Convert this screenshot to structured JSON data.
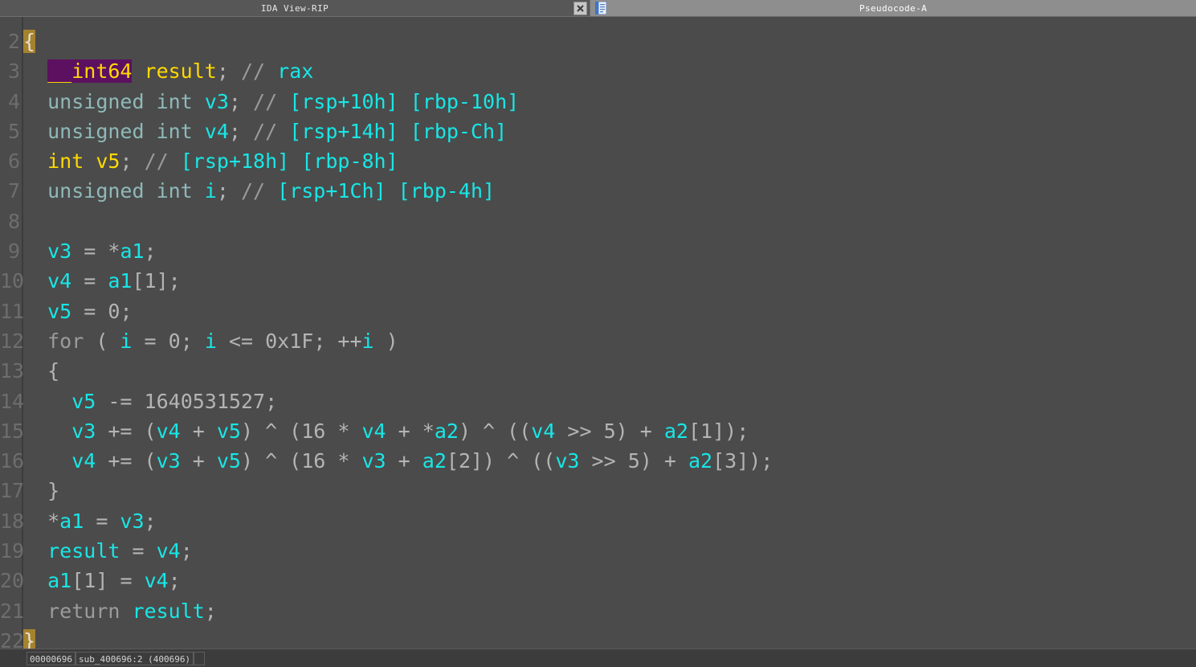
{
  "window": {
    "tabs": [
      {
        "label": "IDA View-RIP",
        "active": false,
        "icon": "close-icon"
      },
      {
        "label": "Pseudocode-A",
        "active": true,
        "icon": "pseudocode-document-icon"
      }
    ],
    "close_glyph": "✖"
  },
  "editor": {
    "first_line_number": 2,
    "lines": [
      {
        "n": "2",
        "tokens": [
          {
            "t": "{",
            "c": "hl-brace"
          }
        ]
      },
      {
        "n": "3",
        "tokens": [
          {
            "t": "  ",
            "c": "punc"
          },
          {
            "t": "__int64",
            "c": "kw hl-type"
          },
          {
            "t": " ",
            "c": "punc"
          },
          {
            "t": "result",
            "c": "fn"
          },
          {
            "t": ";",
            "c": "punc"
          },
          {
            "t": " ",
            "c": "punc"
          },
          {
            "t": "//",
            "c": "cmt"
          },
          {
            "t": " ",
            "c": "punc"
          },
          {
            "t": "rax",
            "c": "reg"
          }
        ]
      },
      {
        "n": "4",
        "tokens": [
          {
            "t": "  ",
            "c": "punc"
          },
          {
            "t": "unsigned int",
            "c": "kwdim"
          },
          {
            "t": " ",
            "c": "punc"
          },
          {
            "t": "v3",
            "c": "var"
          },
          {
            "t": ";",
            "c": "punc"
          },
          {
            "t": " ",
            "c": "punc"
          },
          {
            "t": "//",
            "c": "cmt"
          },
          {
            "t": " ",
            "c": "punc"
          },
          {
            "t": "[rsp+10h] [rbp-10h]",
            "c": "reg"
          }
        ]
      },
      {
        "n": "5",
        "tokens": [
          {
            "t": "  ",
            "c": "punc"
          },
          {
            "t": "unsigned int",
            "c": "kwdim"
          },
          {
            "t": " ",
            "c": "punc"
          },
          {
            "t": "v4",
            "c": "var"
          },
          {
            "t": ";",
            "c": "punc"
          },
          {
            "t": " ",
            "c": "punc"
          },
          {
            "t": "//",
            "c": "cmt"
          },
          {
            "t": " ",
            "c": "punc"
          },
          {
            "t": "[rsp+14h] [rbp-Ch]",
            "c": "reg"
          }
        ]
      },
      {
        "n": "6",
        "tokens": [
          {
            "t": "  ",
            "c": "punc"
          },
          {
            "t": "int",
            "c": "kw"
          },
          {
            "t": " ",
            "c": "punc"
          },
          {
            "t": "v5",
            "c": "fn"
          },
          {
            "t": ";",
            "c": "punc"
          },
          {
            "t": " ",
            "c": "punc"
          },
          {
            "t": "//",
            "c": "cmt"
          },
          {
            "t": " ",
            "c": "punc"
          },
          {
            "t": "[rsp+18h] [rbp-8h]",
            "c": "reg"
          }
        ]
      },
      {
        "n": "7",
        "tokens": [
          {
            "t": "  ",
            "c": "punc"
          },
          {
            "t": "unsigned int",
            "c": "kwdim"
          },
          {
            "t": " ",
            "c": "punc"
          },
          {
            "t": "i",
            "c": "var"
          },
          {
            "t": ";",
            "c": "punc"
          },
          {
            "t": " ",
            "c": "punc"
          },
          {
            "t": "//",
            "c": "cmt"
          },
          {
            "t": " ",
            "c": "punc"
          },
          {
            "t": "[rsp+1Ch] [rbp-4h]",
            "c": "reg"
          }
        ]
      },
      {
        "n": "8",
        "tokens": []
      },
      {
        "n": "9",
        "tokens": [
          {
            "t": "  ",
            "c": "punc"
          },
          {
            "t": "v3",
            "c": "var"
          },
          {
            "t": " = *",
            "c": "punc"
          },
          {
            "t": "a1",
            "c": "var"
          },
          {
            "t": ";",
            "c": "punc"
          }
        ]
      },
      {
        "n": "10",
        "tokens": [
          {
            "t": "  ",
            "c": "punc"
          },
          {
            "t": "v4",
            "c": "var"
          },
          {
            "t": " = ",
            "c": "punc"
          },
          {
            "t": "a1",
            "c": "var"
          },
          {
            "t": "[",
            "c": "punc"
          },
          {
            "t": "1",
            "c": "num"
          },
          {
            "t": "];",
            "c": "punc"
          }
        ]
      },
      {
        "n": "11",
        "tokens": [
          {
            "t": "  ",
            "c": "punc"
          },
          {
            "t": "v5",
            "c": "var"
          },
          {
            "t": " = ",
            "c": "punc"
          },
          {
            "t": "0",
            "c": "num"
          },
          {
            "t": ";",
            "c": "punc"
          }
        ]
      },
      {
        "n": "12",
        "tokens": [
          {
            "t": "  ",
            "c": "punc"
          },
          {
            "t": "for",
            "c": "cmt"
          },
          {
            "t": " ( ",
            "c": "punc"
          },
          {
            "t": "i",
            "c": "var"
          },
          {
            "t": " = ",
            "c": "punc"
          },
          {
            "t": "0",
            "c": "num"
          },
          {
            "t": "; ",
            "c": "punc"
          },
          {
            "t": "i",
            "c": "var"
          },
          {
            "t": " <= ",
            "c": "punc"
          },
          {
            "t": "0x1F",
            "c": "num"
          },
          {
            "t": "; ++",
            "c": "punc"
          },
          {
            "t": "i",
            "c": "var"
          },
          {
            "t": " )",
            "c": "punc"
          }
        ]
      },
      {
        "n": "13",
        "tokens": [
          {
            "t": "  {",
            "c": "punc"
          }
        ]
      },
      {
        "n": "14",
        "tokens": [
          {
            "t": "    ",
            "c": "punc"
          },
          {
            "t": "v5",
            "c": "var"
          },
          {
            "t": " -= ",
            "c": "punc"
          },
          {
            "t": "1640531527",
            "c": "num"
          },
          {
            "t": ";",
            "c": "punc"
          }
        ]
      },
      {
        "n": "15",
        "tokens": [
          {
            "t": "    ",
            "c": "punc"
          },
          {
            "t": "v3",
            "c": "var"
          },
          {
            "t": " += (",
            "c": "punc"
          },
          {
            "t": "v4",
            "c": "var"
          },
          {
            "t": " + ",
            "c": "punc"
          },
          {
            "t": "v5",
            "c": "var"
          },
          {
            "t": ") ^ (",
            "c": "punc"
          },
          {
            "t": "16",
            "c": "num"
          },
          {
            "t": " * ",
            "c": "punc"
          },
          {
            "t": "v4",
            "c": "var"
          },
          {
            "t": " + *",
            "c": "punc"
          },
          {
            "t": "a2",
            "c": "var"
          },
          {
            "t": ") ^ ((",
            "c": "punc"
          },
          {
            "t": "v4",
            "c": "var"
          },
          {
            "t": " >> ",
            "c": "punc"
          },
          {
            "t": "5",
            "c": "num"
          },
          {
            "t": ") + ",
            "c": "punc"
          },
          {
            "t": "a2",
            "c": "var"
          },
          {
            "t": "[",
            "c": "punc"
          },
          {
            "t": "1",
            "c": "num"
          },
          {
            "t": "]);",
            "c": "punc"
          }
        ]
      },
      {
        "n": "16",
        "tokens": [
          {
            "t": "    ",
            "c": "punc"
          },
          {
            "t": "v4",
            "c": "var"
          },
          {
            "t": " += (",
            "c": "punc"
          },
          {
            "t": "v3",
            "c": "var"
          },
          {
            "t": " + ",
            "c": "punc"
          },
          {
            "t": "v5",
            "c": "var"
          },
          {
            "t": ") ^ (",
            "c": "punc"
          },
          {
            "t": "16",
            "c": "num"
          },
          {
            "t": " * ",
            "c": "punc"
          },
          {
            "t": "v3",
            "c": "var"
          },
          {
            "t": " + ",
            "c": "punc"
          },
          {
            "t": "a2",
            "c": "var"
          },
          {
            "t": "[",
            "c": "punc"
          },
          {
            "t": "2",
            "c": "num"
          },
          {
            "t": "]) ^ ((",
            "c": "punc"
          },
          {
            "t": "v3",
            "c": "var"
          },
          {
            "t": " >> ",
            "c": "punc"
          },
          {
            "t": "5",
            "c": "num"
          },
          {
            "t": ") + ",
            "c": "punc"
          },
          {
            "t": "a2",
            "c": "var"
          },
          {
            "t": "[",
            "c": "punc"
          },
          {
            "t": "3",
            "c": "num"
          },
          {
            "t": "]);",
            "c": "punc"
          }
        ]
      },
      {
        "n": "17",
        "tokens": [
          {
            "t": "  }",
            "c": "punc"
          }
        ]
      },
      {
        "n": "18",
        "tokens": [
          {
            "t": "  *",
            "c": "punc"
          },
          {
            "t": "a1",
            "c": "var"
          },
          {
            "t": " = ",
            "c": "punc"
          },
          {
            "t": "v3",
            "c": "var"
          },
          {
            "t": ";",
            "c": "punc"
          }
        ]
      },
      {
        "n": "19",
        "tokens": [
          {
            "t": "  ",
            "c": "punc"
          },
          {
            "t": "result",
            "c": "var"
          },
          {
            "t": " = ",
            "c": "punc"
          },
          {
            "t": "v4",
            "c": "var"
          },
          {
            "t": ";",
            "c": "punc"
          }
        ]
      },
      {
        "n": "20",
        "tokens": [
          {
            "t": "  ",
            "c": "punc"
          },
          {
            "t": "a1",
            "c": "var"
          },
          {
            "t": "[",
            "c": "punc"
          },
          {
            "t": "1",
            "c": "num"
          },
          {
            "t": "] = ",
            "c": "punc"
          },
          {
            "t": "v4",
            "c": "var"
          },
          {
            "t": ";",
            "c": "punc"
          }
        ]
      },
      {
        "n": "21",
        "tokens": [
          {
            "t": "  ",
            "c": "punc"
          },
          {
            "t": "return",
            "c": "cmt"
          },
          {
            "t": " ",
            "c": "punc"
          },
          {
            "t": "result",
            "c": "var"
          },
          {
            "t": ";",
            "c": "punc"
          }
        ]
      },
      {
        "n": "22",
        "tokens": [
          {
            "t": "}",
            "c": "hl-brace"
          }
        ]
      }
    ]
  },
  "statusbar": {
    "offset": "00000696",
    "location": "sub_400696:2  (400696)",
    "extra": ""
  }
}
